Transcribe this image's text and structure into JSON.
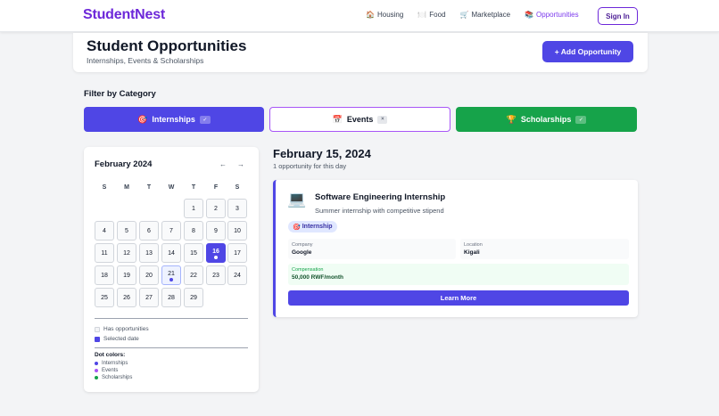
{
  "nav": {
    "brand": "StudentNest",
    "links": [
      {
        "icon": "house-icon",
        "glyph": "🏠",
        "label": "Housing"
      },
      {
        "icon": "plate-icon",
        "glyph": "🍽️",
        "label": "Food"
      },
      {
        "icon": "cart-icon",
        "glyph": "🛒",
        "label": "Marketplace"
      },
      {
        "icon": "books-icon",
        "glyph": "📚",
        "label": "Opportunities"
      }
    ],
    "signin_label": "Sign In"
  },
  "header": {
    "title": "Student Opportunities",
    "subtitle": "Internships, Events & Scholarships",
    "add_label": "+ Add Opportunity"
  },
  "filter": {
    "title": "Filter by Category",
    "categories": [
      {
        "glyph": "🎯",
        "label": "Internships",
        "mark": "✓",
        "active": true
      },
      {
        "glyph": "📅",
        "label": "Events",
        "mark": "×",
        "active": false
      },
      {
        "glyph": "🏆",
        "label": "Scholarships",
        "mark": "✓",
        "active": true
      }
    ]
  },
  "calendar": {
    "month": "February 2024",
    "prev": "←",
    "next": "→",
    "weekdays": [
      "S",
      "M",
      "T",
      "W",
      "T",
      "F",
      "S"
    ],
    "days": [
      "1",
      "2",
      "3",
      "4",
      "5",
      "6",
      "7",
      "8",
      "9",
      "10",
      "11",
      "12",
      "13",
      "14",
      "15",
      "16",
      "17",
      "18",
      "19",
      "20",
      "21",
      "22",
      "23",
      "24",
      "25",
      "26",
      "27",
      "28",
      "29"
    ],
    "selected_day": "16",
    "highlighted_day": "21",
    "legend": {
      "has_opportunities": "Has opportunities",
      "selected_date": "Selected date",
      "dot_colors_title": "Dot colors:",
      "dot_internships": "Internships",
      "dot_events": "Events",
      "dot_scholarships": "Scholarships"
    }
  },
  "colors": {
    "primary": "#4f46e5",
    "brand": "#6d28d9",
    "events": "#a855f7",
    "scholarships": "#16a34a"
  },
  "detail": {
    "date": "February 15, 2024",
    "count": "1 opportunity for this day",
    "card": {
      "icon_glyph": "💻",
      "title": "Software Engineering Internship",
      "description": "Summer internship with competitive stipend",
      "badge_glyph": "🎯",
      "badge": "Internship",
      "company_label": "Company",
      "company": "Google",
      "location_label": "Location",
      "location": "Kigali",
      "compensation_label": "Compensation",
      "compensation": "50,000 RWF/month",
      "learn_more": "Learn More"
    }
  }
}
